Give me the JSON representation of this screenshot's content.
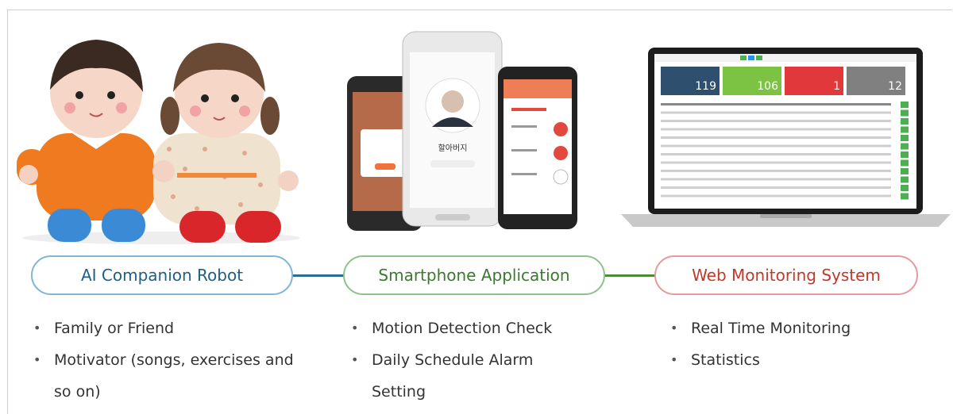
{
  "robot": {
    "title": "AI Companion Robot",
    "bullets": [
      "Family or Friend",
      "Motivator (songs, exercises and so on)"
    ]
  },
  "app": {
    "title": "Smartphone Application",
    "bullets": [
      "Motion Detection Check",
      "Daily Schedule Alarm Setting"
    ],
    "phone_caption": "할아버지"
  },
  "web": {
    "title": "Web Monitoring System",
    "bullets": [
      "Real Time Monitoring",
      "Statistics"
    ],
    "stats": [
      {
        "value": "119",
        "color": "#2f4f6f"
      },
      {
        "value": "106",
        "color": "#7cc243"
      },
      {
        "value": "1",
        "color": "#e0383b"
      },
      {
        "value": "12",
        "color": "#808080"
      }
    ]
  },
  "colors": {
    "blue": "#1f5f86",
    "green": "#3a7a2e",
    "red": "#c0392b"
  }
}
